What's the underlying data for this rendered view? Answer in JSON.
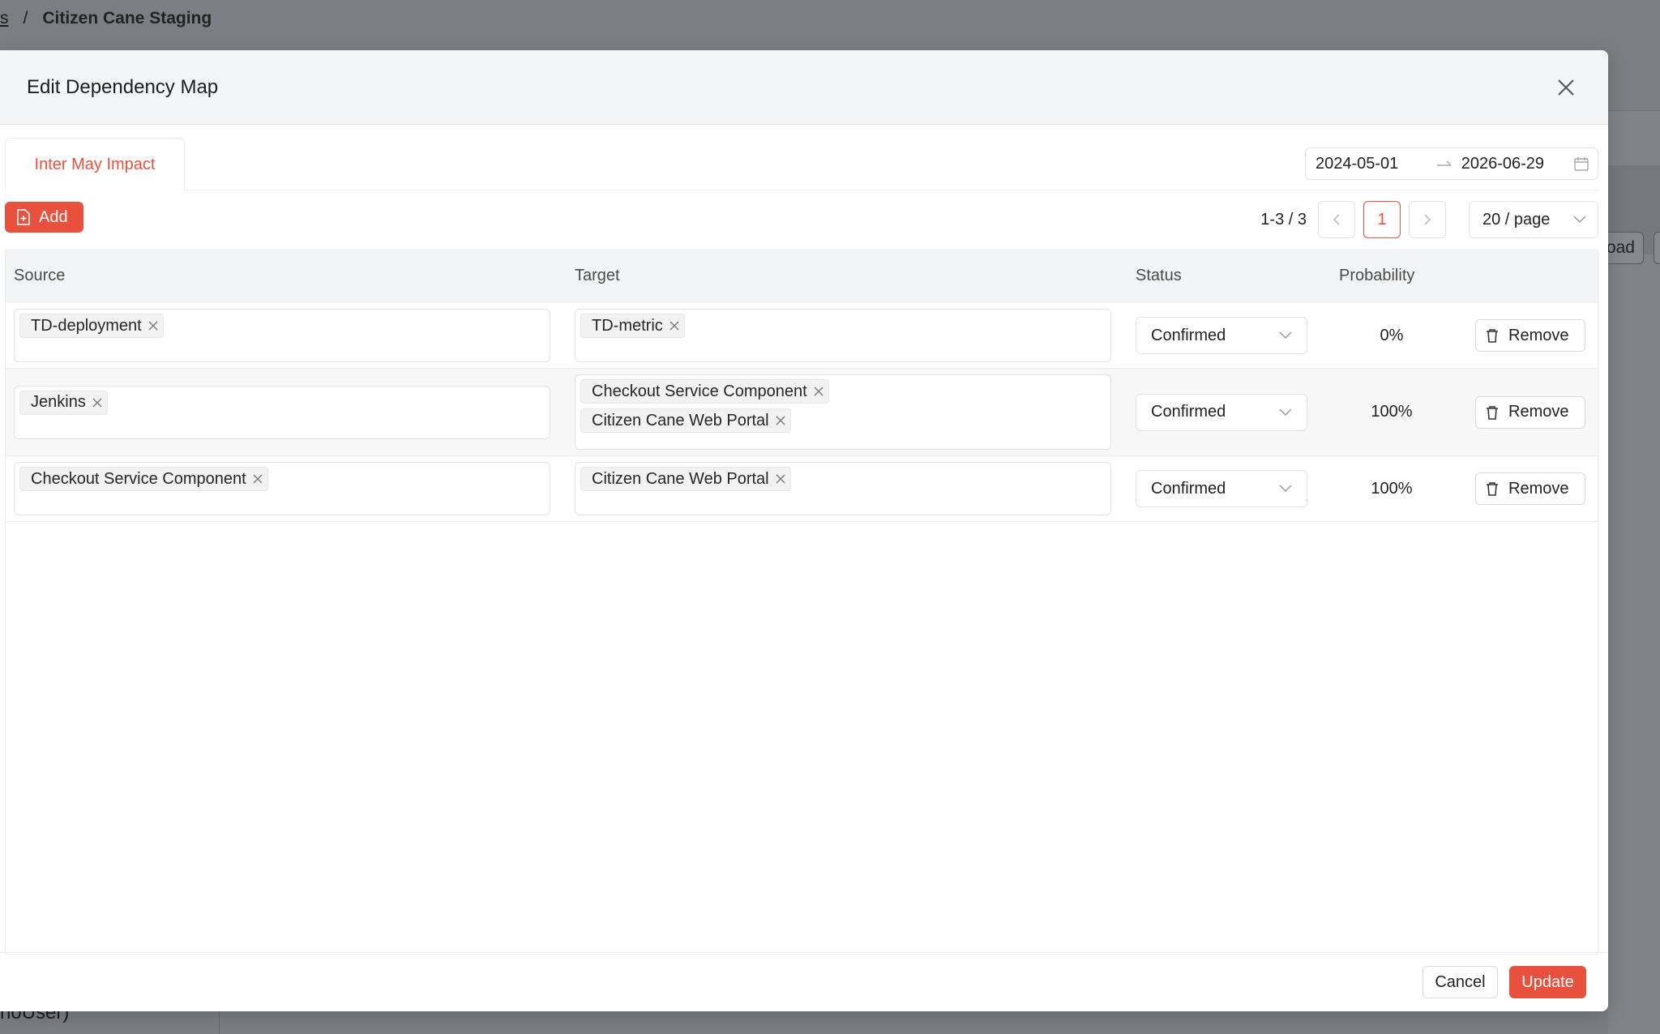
{
  "background": {
    "breadcrumb_link": "s",
    "breadcrumb_sep": "/",
    "breadcrumb_current": "Citizen Cane Staging",
    "load_button_label": "oad",
    "bottom_text": "noUser)"
  },
  "modal": {
    "title": "Edit Dependency Map",
    "tab_label": "Inter May Impact",
    "date_start": "2024-05-01",
    "date_end": "2026-06-29",
    "add_label": "Add",
    "pager": {
      "range": "1-3 / 3",
      "current_page": "1",
      "page_size": "20 / page"
    },
    "columns": {
      "source": "Source",
      "target": "Target",
      "status": "Status",
      "probability": "Probability"
    },
    "rows": [
      {
        "source": [
          "TD-deployment"
        ],
        "target": [
          "TD-metric"
        ],
        "status": "Confirmed",
        "probability": "0%",
        "remove_label": "Remove"
      },
      {
        "source": [
          "Jenkins"
        ],
        "target": [
          "Checkout Service Component",
          "Citizen Cane Web Portal"
        ],
        "status": "Confirmed",
        "probability": "100%",
        "remove_label": "Remove"
      },
      {
        "source": [
          "Checkout Service Component"
        ],
        "target": [
          "Citizen Cane Web Portal"
        ],
        "status": "Confirmed",
        "probability": "100%",
        "remove_label": "Remove"
      }
    ],
    "cancel_label": "Cancel",
    "update_label": "Update"
  },
  "colors": {
    "accent": "#e8513e",
    "overlay": "#7b7e83"
  }
}
